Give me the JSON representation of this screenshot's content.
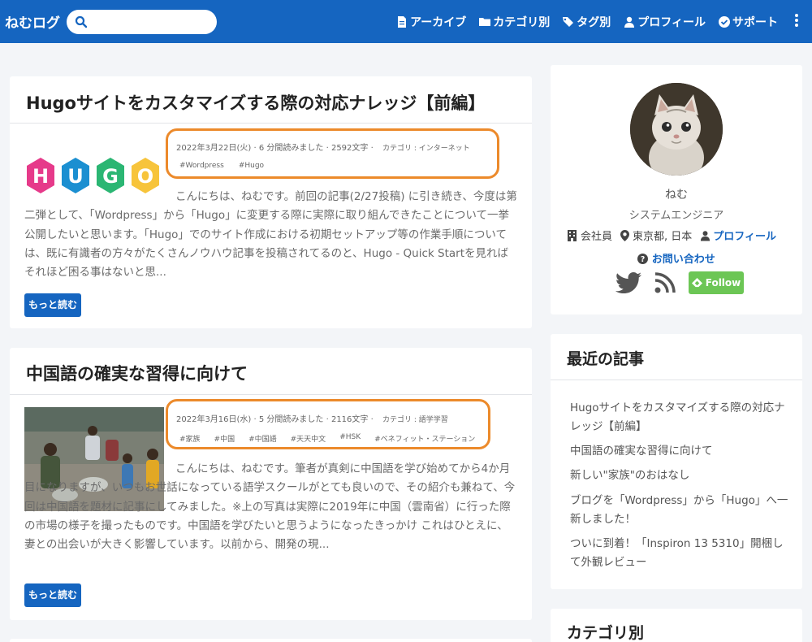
{
  "header": {
    "brand": "ねむログ",
    "search_placeholder": "",
    "nav": [
      {
        "label": "アーカイブ",
        "icon": "file-icon"
      },
      {
        "label": "カテゴリ別",
        "icon": "folder-icon"
      },
      {
        "label": "タグ別",
        "icon": "tags-icon"
      },
      {
        "label": "プロフィール",
        "icon": "user-icon"
      },
      {
        "label": "サポート",
        "icon": "check-circle-icon"
      }
    ]
  },
  "posts": [
    {
      "title": "Hugoサイトをカスタマイズする際の対応ナレッジ【前編】",
      "meta": "2022年3月22日(火) · 6 分間読みました · 2592文字 ·",
      "category": "カテゴリ : インターネット",
      "tags": [
        "#Wordpress",
        "#Hugo"
      ],
      "excerpt": "こんにちは、ねむです。前回の記事(2/27投稿) に引き続き、今度は第二弾として、「Wordpress」から「Hugo」に変更する際に実際に取り組んできたことについて一挙公開したいと思います。「Hugo」でのサイト作成における初期セットアップ等の作業手順については、既に有識者の方々がたくさんノウハウ記事を投稿されてるのと、Hugo - Quick Startを見ればそれほど困る事はないと思...",
      "read_more": "もっと読む",
      "thumb_text": "HUGO"
    },
    {
      "title": "中国語の確実な習得に向けて",
      "meta": "2022年3月16日(水) · 5 分間読みました · 2116文字 ·",
      "category": "カテゴリ : 語学学習",
      "tags": [
        "#家族",
        "#中国",
        "#中国語",
        "#天天中文",
        "#HSK",
        "#ベネフィット・ステーション"
      ],
      "excerpt": "こんにちは、ねむです。筆者が真剣に中国語を学び始めてから4か月目になりますが、いつもお世話になっている語学スクールがとても良いので、その紹介も兼ねて、今回は中国語を題材に記事にしてみました。※上の写真は実際に2019年に中国（雲南省）に行った際の市場の様子を撮ったものです。中国語を学びたいと思うようになったきっかけ これはひとえに、妻との出会いが大きく影響しています。以前から、開発の現...",
      "read_more": "もっと読む"
    }
  ],
  "profile": {
    "name": "ねむ",
    "role": "システムエンジニア",
    "company": "会社員",
    "location": "東京都, 日本",
    "profile_link": "プロフィール",
    "contact": "お問い合わせ",
    "follow": "Follow"
  },
  "recent": {
    "title": "最近の記事",
    "items": [
      "Hugoサイトをカスタマイズする際の対応ナレッジ【前編】",
      "中国語の確実な習得に向けて",
      "新しい\"家族\"のおはなし",
      "ブログを「Wordpress」から「Hugo」へ一新しました！",
      "ついに到着！「Inspiron 13 5310」開梱して外観レビュー"
    ]
  },
  "categories": {
    "title": "カテゴリ別"
  },
  "colors": {
    "primary": "#1565c0",
    "highlight": "#ec8a2b",
    "follow": "#6cc655"
  }
}
